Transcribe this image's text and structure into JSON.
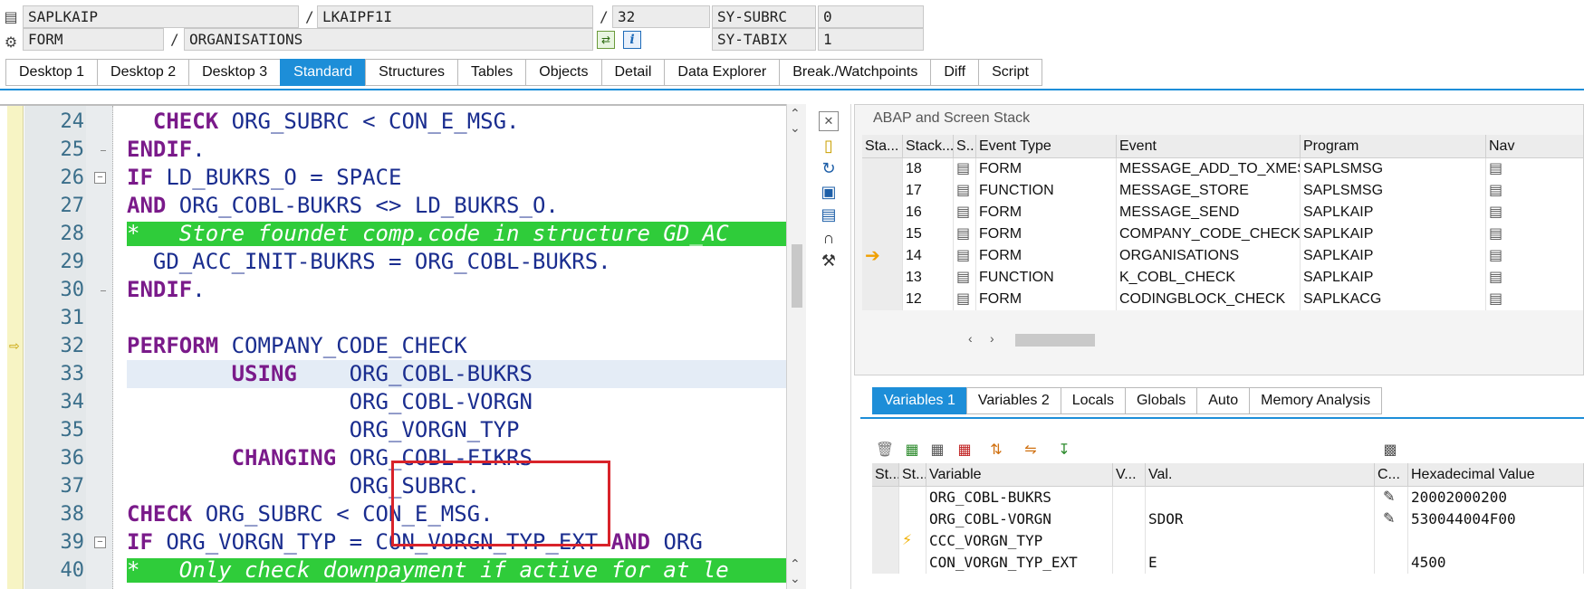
{
  "header": {
    "program": "SAPLKAIP",
    "include": "LKAIPF1I",
    "line_no": "32",
    "sy1_name": "SY-SUBRC",
    "sy1_value": "0",
    "event_type": "FORM",
    "event": "ORGANISATIONS",
    "sy2_name": "SY-TABIX",
    "sy2_value": "1",
    "sep": "/"
  },
  "top_tabs": [
    "Desktop 1",
    "Desktop 2",
    "Desktop 3",
    "Standard",
    "Structures",
    "Tables",
    "Objects",
    "Detail",
    "Data Explorer",
    "Break./Watchpoints",
    "Diff",
    "Script"
  ],
  "active_top_tab": "Standard",
  "editor": {
    "lines": [
      {
        "no": "24",
        "kw": "  CHECK",
        "text": " ORG_SUBRC < CON_E_MSG."
      },
      {
        "no": "25",
        "kw": "ENDIF",
        "text": "."
      },
      {
        "no": "26",
        "kw": "IF",
        "text": " LD_BUKRS_O = SPACE"
      },
      {
        "no": "27",
        "kw": "AND",
        "text": " ORG_COBL-BUKRS <> LD_BUKRS_O."
      },
      {
        "no": "28",
        "kw": "",
        "text": "*   Store foundet comp.code in structure GD_AC"
      },
      {
        "no": "29",
        "kw": "",
        "text": "  GD_ACC_INIT-BUKRS = ORG_COBL-BUKRS."
      },
      {
        "no": "30",
        "kw": "ENDIF",
        "text": "."
      },
      {
        "no": "31",
        "kw": "",
        "text": ""
      },
      {
        "no": "32",
        "kw": "PERFORM",
        "text": " COMPANY_CODE_CHECK"
      },
      {
        "no": "33",
        "kw": "        USING",
        "text": "    ORG_COBL-BUKRS"
      },
      {
        "no": "34",
        "kw": "",
        "text": "                 ORG_COBL-VORGN"
      },
      {
        "no": "35",
        "kw": "",
        "text": "                 ORG_VORGN_TYP"
      },
      {
        "no": "36",
        "kw": "        CHANGING",
        "text": " ORG_COBL-FIKRS"
      },
      {
        "no": "37",
        "kw": "",
        "text": "                 ORG_SUBRC."
      },
      {
        "no": "38",
        "kw": "CHECK",
        "text": " ORG_SUBRC < CON_E_MSG."
      },
      {
        "no": "39",
        "kw": "IF",
        "text": " ORG_VORGN_TYP = CON_VORGN_TYP_EXT "
      },
      {
        "no": "40",
        "kw": "",
        "text": "*   Only check downpayment if active for at le"
      }
    ],
    "line39_tail_kw": "AND",
    "line39_tail": " ORG"
  },
  "stack": {
    "title": "ABAP and Screen Stack",
    "columns": [
      "Sta...",
      "Stack...",
      "S...",
      "Event Type",
      "Event",
      "Program",
      "Nav"
    ],
    "rows": [
      {
        "level": "18",
        "type": "FORM",
        "event": "MESSAGE_ADD_TO_XMESG",
        "program": "SAPLSMSG",
        "current": false
      },
      {
        "level": "17",
        "type": "FUNCTION",
        "event": "MESSAGE_STORE",
        "program": "SAPLSMSG",
        "current": false
      },
      {
        "level": "16",
        "type": "FORM",
        "event": "MESSAGE_SEND",
        "program": "SAPLKAIP",
        "current": false
      },
      {
        "level": "15",
        "type": "FORM",
        "event": "COMPANY_CODE_CHECK",
        "program": "SAPLKAIP",
        "current": false
      },
      {
        "level": "14",
        "type": "FORM",
        "event": "ORGANISATIONS",
        "program": "SAPLKAIP",
        "current": true
      },
      {
        "level": "13",
        "type": "FUNCTION",
        "event": "K_COBL_CHECK",
        "program": "SAPLKAIP",
        "current": false
      },
      {
        "level": "12",
        "type": "FORM",
        "event": "CODINGBLOCK_CHECK",
        "program": "SAPLKACG",
        "current": false
      }
    ]
  },
  "var_tabs": [
    "Variables 1",
    "Variables 2",
    "Locals",
    "Globals",
    "Auto",
    "Memory Analysis"
  ],
  "active_var_tab": "Variables 1",
  "variables": {
    "columns": [
      "St...",
      "Variable",
      "V...",
      "Val.",
      "C...",
      "Hexadecimal Value"
    ],
    "rows": [
      {
        "name": "ORG_COBL-BUKRS",
        "value": "",
        "hex": "20002000200",
        "edit": true,
        "status": ""
      },
      {
        "name": "ORG_COBL-VORGN",
        "value": "SDOR",
        "hex": "530044004F00",
        "edit": true,
        "status": ""
      },
      {
        "name": "CCC_VORGN_TYP",
        "value": "",
        "hex": "",
        "edit": false,
        "status": "lightning"
      },
      {
        "name": "CON_VORGN_TYP_EXT",
        "value": "E",
        "hex": "4500",
        "edit": false,
        "status": ""
      }
    ]
  },
  "colors": {
    "accent": "#1d8ed8",
    "comment_bg": "#2fcc3a",
    "keyword": "#7a1a8a",
    "code": "#1a2d8f",
    "highlight_box": "#d8232a"
  }
}
